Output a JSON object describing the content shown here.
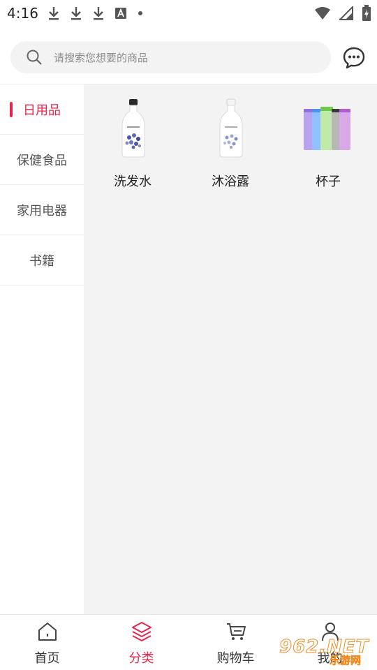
{
  "status_bar": {
    "time": "4:16",
    "icons_left": [
      "download-icon",
      "download-icon",
      "download-icon",
      "keyboard-a-icon",
      "dot-icon"
    ],
    "icons_right": [
      "wifi-icon",
      "signal-icon",
      "battery-charging-icon"
    ]
  },
  "search": {
    "placeholder": "请搜索您想要的商品",
    "icon": "search-icon"
  },
  "header": {
    "message_icon": "chat-bubble-icon"
  },
  "sidebar": {
    "items": [
      {
        "label": "日用品",
        "active": true
      },
      {
        "label": "保健食品",
        "active": false
      },
      {
        "label": "家用电器",
        "active": false
      },
      {
        "label": "书籍",
        "active": false
      }
    ]
  },
  "products": [
    {
      "name": "洗发水",
      "image": "shampoo-bottle"
    },
    {
      "name": "沐浴露",
      "image": "body-wash-bottle"
    },
    {
      "name": "杯子",
      "image": "cups"
    }
  ],
  "bottom_nav": {
    "items": [
      {
        "label": "首页",
        "icon": "home-icon",
        "active": false
      },
      {
        "label": "分类",
        "icon": "layers-icon",
        "active": true
      },
      {
        "label": "购物车",
        "icon": "cart-icon",
        "active": false
      },
      {
        "label": "我的",
        "icon": "user-icon",
        "active": false
      }
    ]
  },
  "watermark": {
    "brand": "962.NET",
    "sub": "乐游网"
  },
  "colors": {
    "accent": "#e8254a",
    "content_bg": "#f3f3f3",
    "search_bg": "#f3f3f3"
  }
}
